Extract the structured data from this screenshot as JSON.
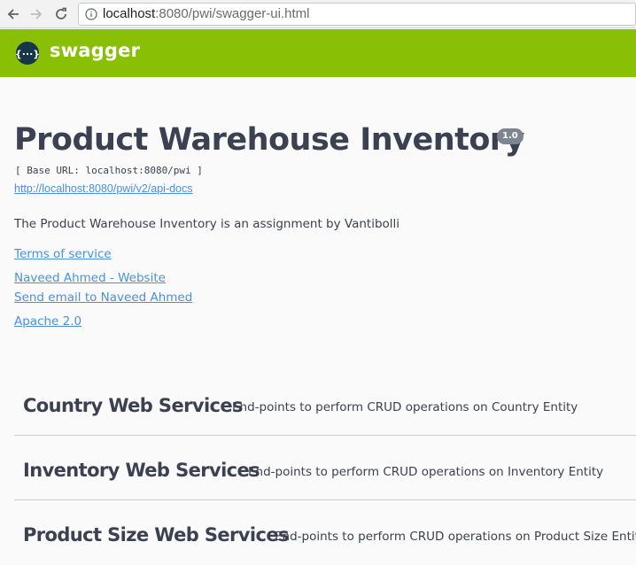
{
  "browser": {
    "url_host": "localhost",
    "url_path": ":8080/pwi/swagger-ui.html"
  },
  "topbar": {
    "logo_text": "swagger",
    "brand_color": "#89bf04"
  },
  "info": {
    "title": "Product Warehouse Inventory",
    "version": "1.0",
    "base_url": "[ Base URL: localhost:8080/pwi ]",
    "api_docs_link": "http://localhost:8080/pwi/v2/api-docs",
    "description": "The Product Warehouse Inventory is an assignment by Vantibolli",
    "terms_link": "Terms of service",
    "website_link": "Naveed Ahmed - Website",
    "email_link": "Send email to Naveed Ahmed",
    "license_link": "Apache 2.0"
  },
  "tags": [
    {
      "name": "Country Web Services",
      "description": "End-points to perform CRUD operations on Country Entity"
    },
    {
      "name": "Inventory Web Services",
      "description": "End-points to perform CRUD operations on Inventory Entity"
    },
    {
      "name": "Product Size Web Services",
      "description": "End-points to perform CRUD operations on Product Size Entity"
    }
  ]
}
